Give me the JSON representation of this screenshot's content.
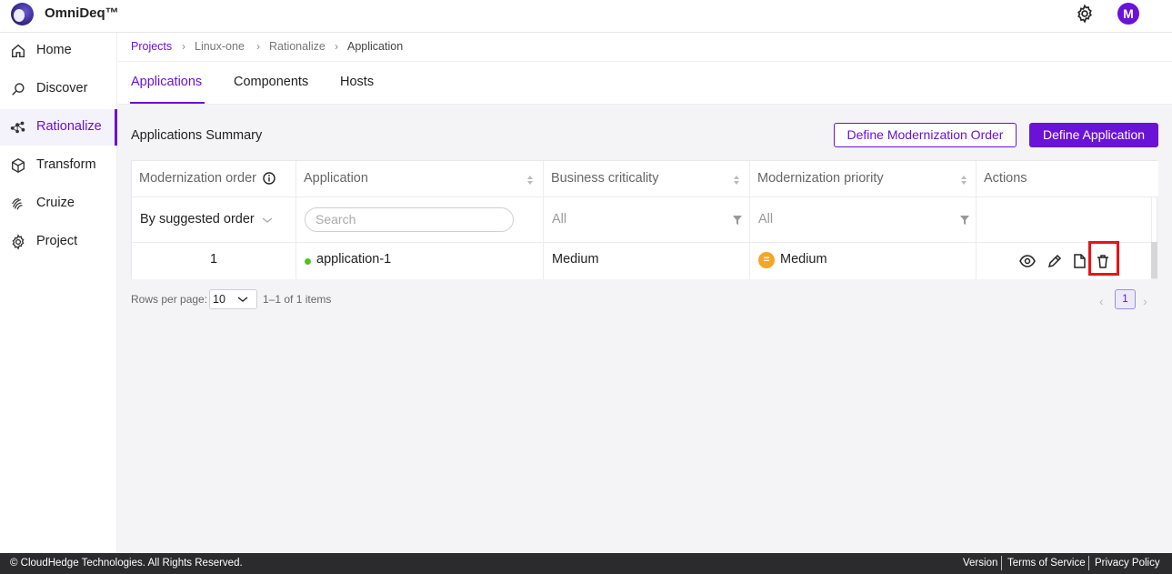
{
  "app": {
    "brand": "OmniDeq™",
    "avatar_initial": "M"
  },
  "sidebar": {
    "items": [
      {
        "label": "Home",
        "icon": "home-icon"
      },
      {
        "label": "Discover",
        "icon": "search-icon"
      },
      {
        "label": "Rationalize",
        "icon": "network-icon",
        "active": true
      },
      {
        "label": "Transform",
        "icon": "cube-icon"
      },
      {
        "label": "Cruize",
        "icon": "fingerprint-icon"
      },
      {
        "label": "Project",
        "icon": "gear-icon"
      }
    ]
  },
  "breadcrumb": [
    "Projects",
    "Linux-one",
    "Rationalize",
    "Application"
  ],
  "tabs": [
    "Applications",
    "Components",
    "Hosts"
  ],
  "summary": {
    "title": "Applications Summary",
    "define_order_label": "Define Modernization Order",
    "define_app_label": "Define Application"
  },
  "table": {
    "headers": [
      "Modernization order",
      "Application",
      "Business criticality",
      "Modernization priority",
      "Actions"
    ],
    "filters": {
      "order": "By suggested order",
      "search_placeholder": "Search",
      "criticality": "All",
      "priority": "All"
    },
    "rows": [
      {
        "order": "1",
        "application": "application-1",
        "criticality": "Medium",
        "priority": "Medium",
        "priority_symbol": "="
      }
    ]
  },
  "pagination": {
    "rows_per_page_label": "Rows per page:",
    "rows_per_page": "10",
    "range": "1–1 of 1 items",
    "current_page": "1"
  },
  "footer": {
    "copyright": "© CloudHedge Technologies. All Rights Reserved.",
    "links": [
      "Version",
      "Terms of Service",
      "Privacy Policy"
    ]
  },
  "colors": {
    "accent": "#6a12d8",
    "status_green": "#52c41a",
    "priority_medium": "#f5a623",
    "highlight": "#ee1111"
  }
}
